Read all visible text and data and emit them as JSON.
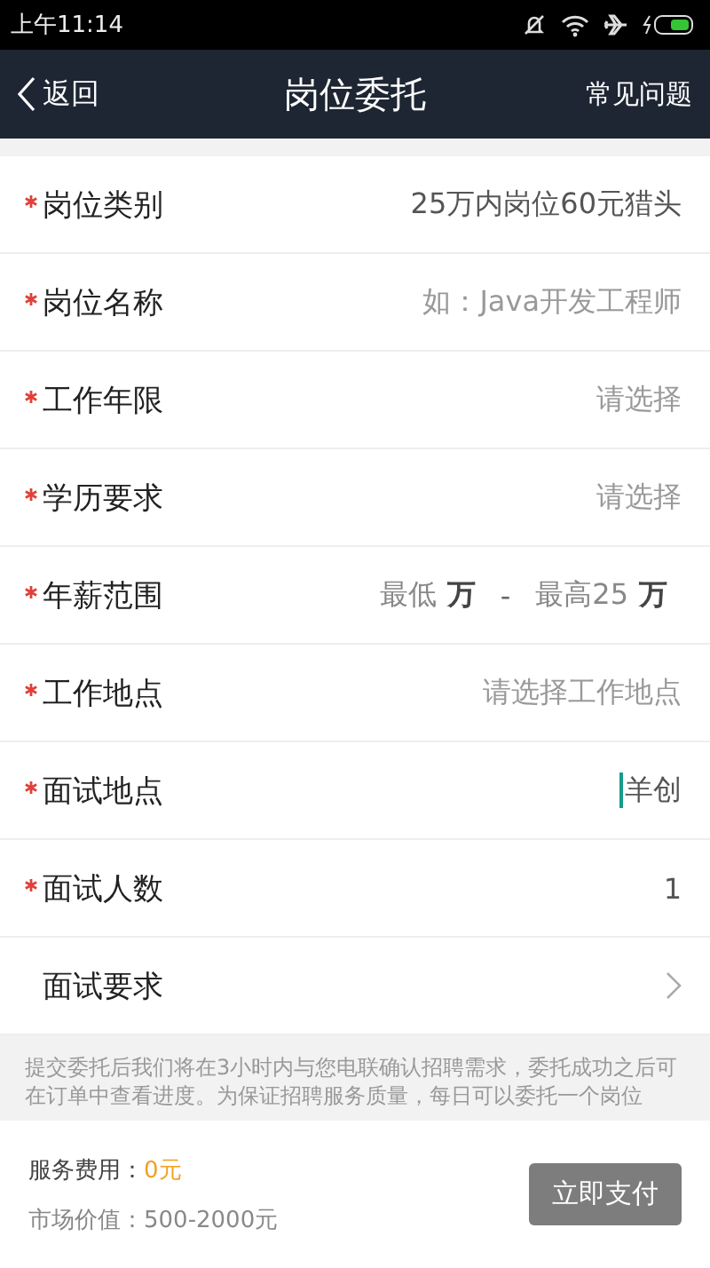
{
  "status_bar": {
    "time": "上午11:14"
  },
  "nav": {
    "back": "返回",
    "title": "岗位委托",
    "action": "常见问题"
  },
  "fields": [
    {
      "kind": "select",
      "label": "岗位类别",
      "required": true,
      "value": "25万内岗位60元猎头"
    },
    {
      "kind": "input",
      "label": "岗位名称",
      "required": true,
      "placeholder": "如：Java开发工程师"
    },
    {
      "kind": "select",
      "label": "工作年限",
      "required": true,
      "placeholder": "请选择"
    },
    {
      "kind": "select",
      "label": "学历要求",
      "required": true,
      "placeholder": "请选择"
    },
    {
      "kind": "range",
      "label": "年薪范围",
      "required": true,
      "min_placeholder": "最低",
      "min_unit": "万",
      "separator": "-",
      "max_value": "最高25",
      "max_unit": "万"
    },
    {
      "kind": "select",
      "label": "工作地点",
      "required": true,
      "placeholder": "请选择工作地点"
    },
    {
      "kind": "input",
      "label": "面试地点",
      "required": true,
      "value": "羊创",
      "focused": true
    },
    {
      "kind": "input",
      "label": "面试人数",
      "required": true,
      "value": "1"
    },
    {
      "kind": "link",
      "label": "面试要求",
      "required": false
    }
  ],
  "notice": "提交委托后我们将在3小时内与您电联确认招聘需求，委托成功之后可在订单中查看进度。为保证招聘服务质量，每日可以委托一个岗位",
  "footer": {
    "fee_label": "服务费用：",
    "fee_value": "0元",
    "market": "市场价值：500-2000元",
    "pay": "立即支付"
  }
}
